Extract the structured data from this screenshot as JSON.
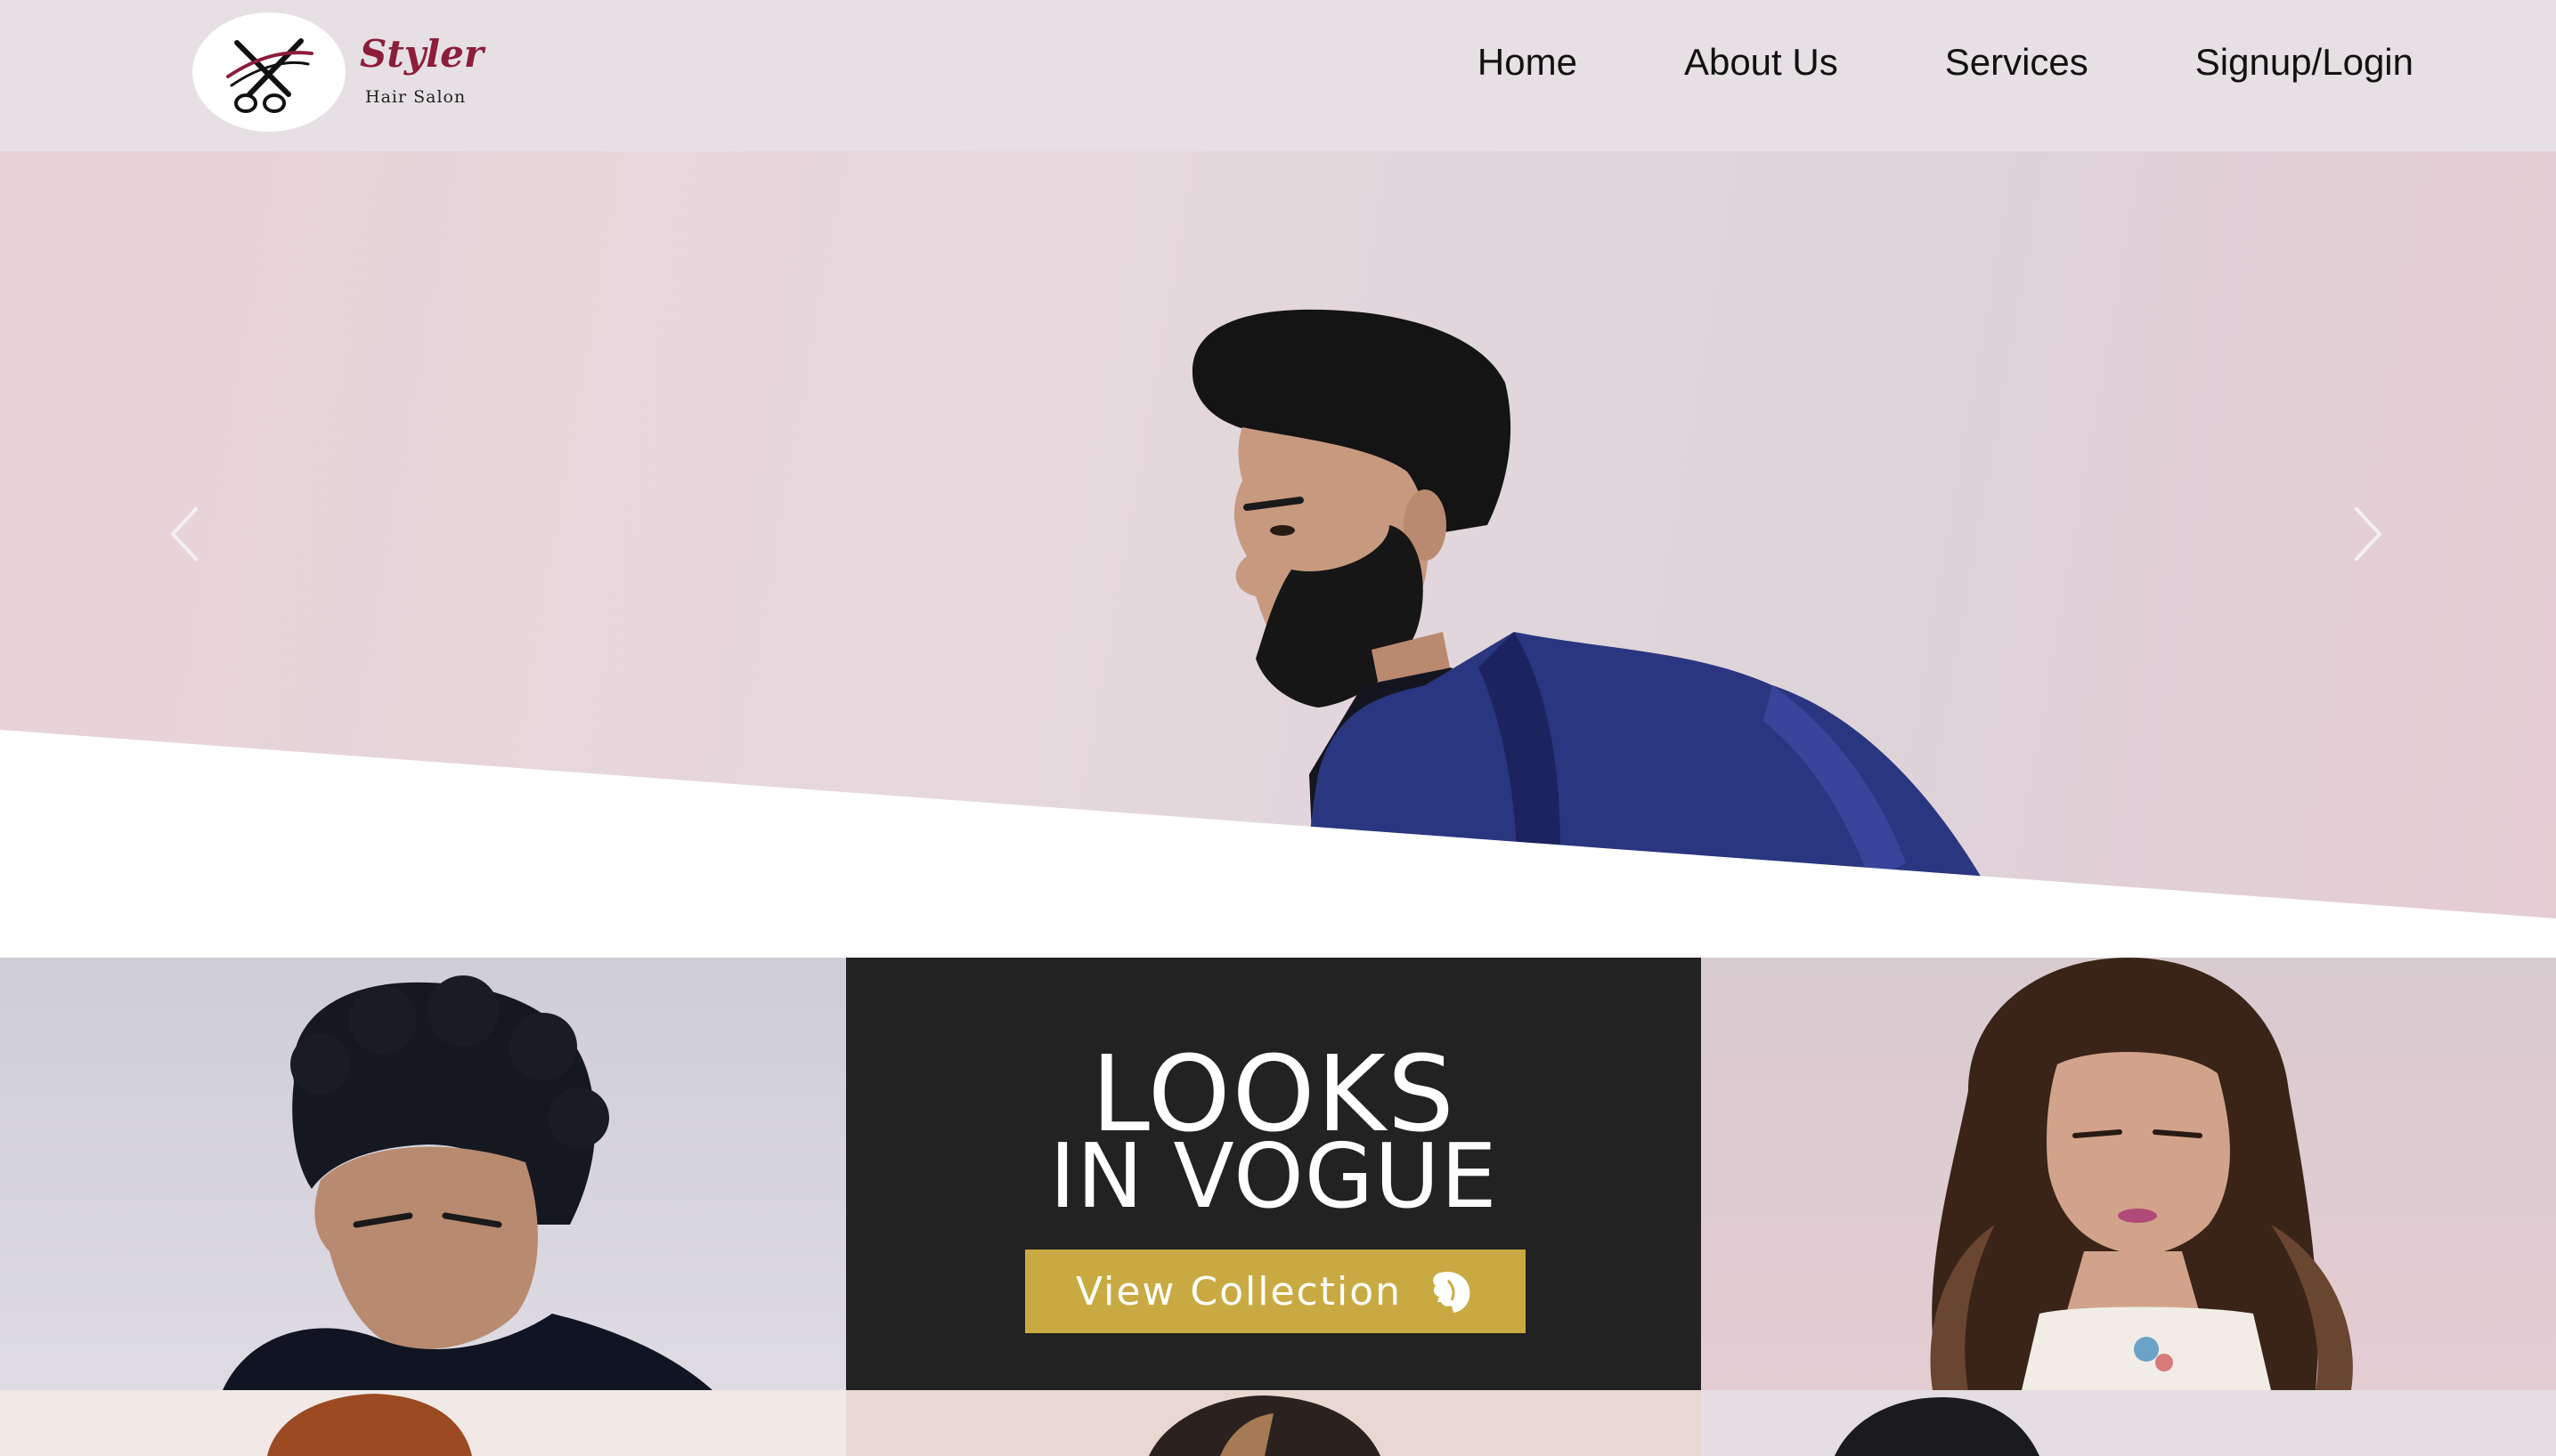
{
  "brand": {
    "name": "Styler",
    "tagline": "Hair Salon",
    "logo_icon": "scissors-icon",
    "color": "#8c1d3b"
  },
  "nav": {
    "items": [
      {
        "label": "Home"
      },
      {
        "label": "About Us"
      },
      {
        "label": "Services"
      },
      {
        "label": "Signup/Login"
      }
    ]
  },
  "hero": {
    "prev_icon": "chevron-left-icon",
    "next_icon": "chevron-right-icon"
  },
  "promo": {
    "line1": "LOOKS",
    "line2": "IN VOGUE",
    "button_label": "View Collection",
    "button_icon": "face-profile-icon",
    "button_color": "#c9aa42",
    "background": "#222222"
  },
  "colors": {
    "header_bg": "#e6e0e5",
    "hero_bg": "#e8d2d7"
  }
}
